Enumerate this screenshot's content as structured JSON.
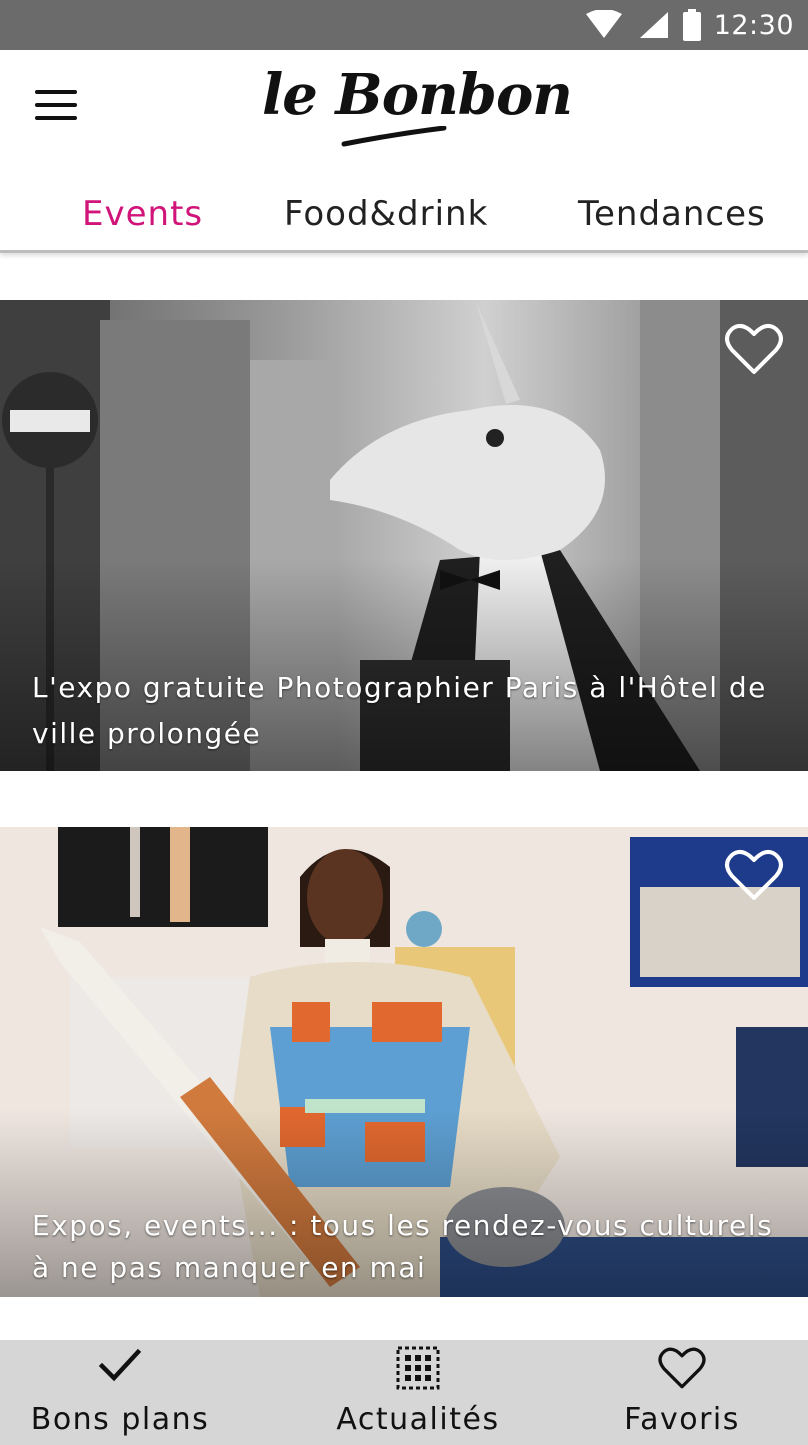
{
  "status_bar": {
    "time": "12:30",
    "icons": [
      "wifi-icon",
      "signal-icon",
      "battery-icon"
    ]
  },
  "header": {
    "logo_text": "le Bonbon",
    "menu_icon": "menu-icon"
  },
  "tabs": [
    {
      "label": "Events",
      "active": true
    },
    {
      "label": "Food&drink",
      "active": false
    },
    {
      "label": "Tendances",
      "active": false
    }
  ],
  "feed": [
    {
      "title": "L'expo gratuite Photographier Paris à l'Hôtel de ville prolongée",
      "favorite_icon": "heart-icon"
    },
    {
      "title": "Expos, events... : tous les rendez-vous culturels à ne pas manquer en mai",
      "favorite_icon": "heart-icon"
    }
  ],
  "bottom_nav": [
    {
      "label": "Bons plans",
      "icon": "check-icon"
    },
    {
      "label": "Actualités",
      "icon": "grid-icon"
    },
    {
      "label": "Favoris",
      "icon": "heart-icon"
    }
  ],
  "colors": {
    "accent": "#d0147a",
    "status_bar": "#6b6b6b",
    "bottom_nav": "#d6d6d6"
  }
}
